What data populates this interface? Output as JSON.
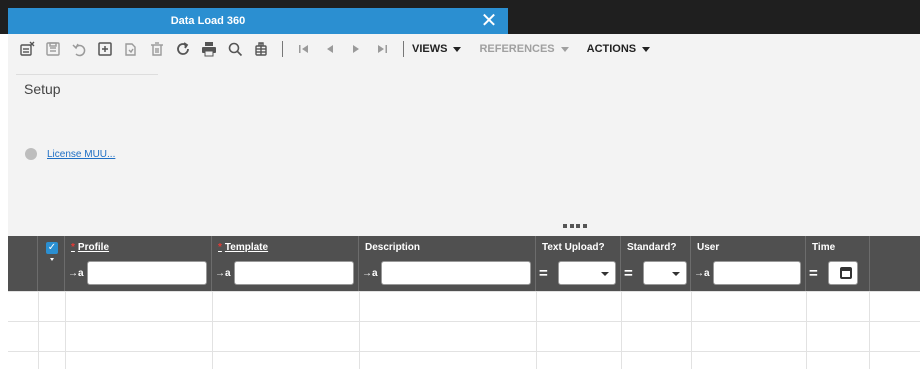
{
  "tab": {
    "title": "Data Load 360",
    "close_glyph": "✕"
  },
  "toolbar": {
    "icons": [
      "new-record-icon",
      "save-icon",
      "undo-icon",
      "export-icon",
      "copy-icon",
      "delete-icon",
      "refresh-icon",
      "print-icon",
      "search-icon",
      "attachment-icon",
      "first-page-icon",
      "previous-page-icon",
      "next-page-icon",
      "last-page-icon"
    ],
    "menus": [
      {
        "label": "VIEWS",
        "enabled": true
      },
      {
        "label": "REFERENCES",
        "enabled": false
      },
      {
        "label": "ACTIONS",
        "enabled": true
      }
    ]
  },
  "setup": {
    "title": "Setup",
    "link": "License MUU..."
  },
  "grid": {
    "columns": [
      {
        "label": "Profile",
        "required": true,
        "link": true,
        "filter_op": "→a"
      },
      {
        "label": "Template",
        "required": true,
        "link": true,
        "filter_op": "→a"
      },
      {
        "label": "Description",
        "required": false,
        "link": false,
        "filter_op": "→a"
      },
      {
        "label": "Text Upload?",
        "required": false,
        "link": false,
        "filter_op": "="
      },
      {
        "label": "Standard?",
        "required": false,
        "link": false,
        "filter_op": "="
      },
      {
        "label": "User",
        "required": false,
        "link": false,
        "filter_op": "→a"
      },
      {
        "label": "Time",
        "required": false,
        "link": false,
        "filter_op": "="
      }
    ],
    "rows": 3
  },
  "colors": {
    "accent": "#2b8fd1",
    "header_bg": "#505050",
    "required": "#e53935",
    "link": "#1f6fc4"
  }
}
